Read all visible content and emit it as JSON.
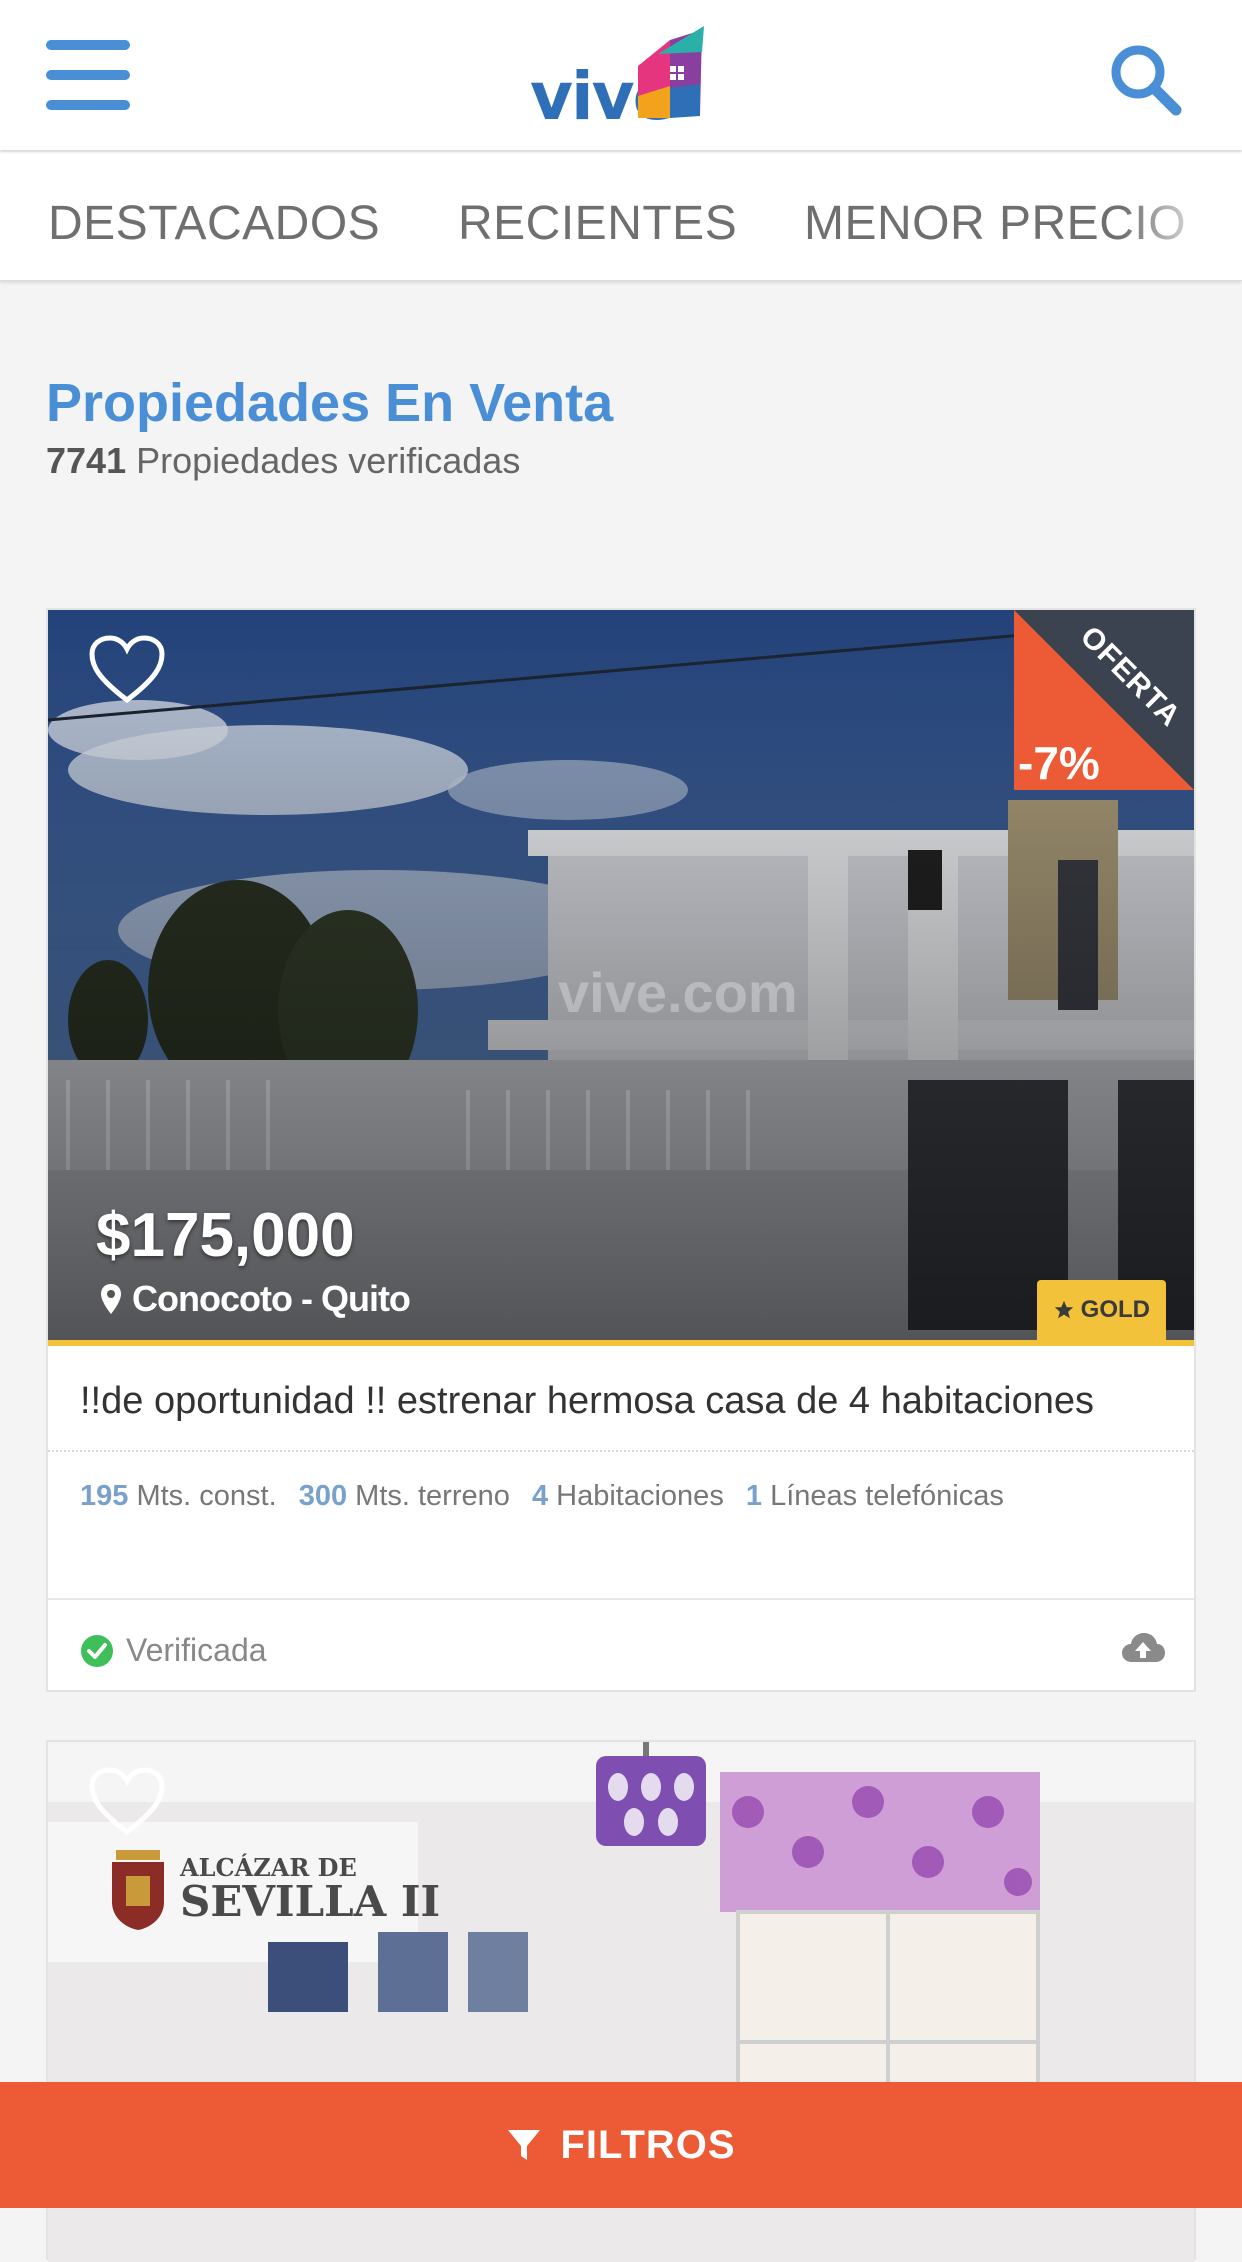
{
  "header": {
    "logo_text": "vive",
    "menu_icon": "hamburger-menu-icon",
    "search_icon": "search-icon",
    "accent_color": "#4a8fd6"
  },
  "tabs": [
    {
      "label": "DESTACADOS"
    },
    {
      "label": "RECIENTES"
    },
    {
      "label": "MENOR PRECIO"
    }
  ],
  "section": {
    "title": "Propiedades En Venta",
    "count": "7741",
    "count_label": "Propiedades verificadas"
  },
  "listings": [
    {
      "offer_label": "OFERTA",
      "offer_discount": "-7%",
      "price": "$175,000",
      "location": "Conocoto - Quito",
      "badge": "GOLD",
      "title": "!!de oportunidad !! estrenar hermosa casa de 4 habitaciones",
      "features": [
        {
          "value": "195",
          "label": "Mts. const."
        },
        {
          "value": "300",
          "label": "Mts. terreno"
        },
        {
          "value": "4",
          "label": "Habitaciones"
        },
        {
          "value": "1",
          "label": "Líneas telefónicas"
        }
      ],
      "status": "Verificada",
      "watermark": "vive.com"
    },
    {
      "photo_logo_line1": "ALCÁZAR DE",
      "photo_logo_line2": "SEVILLA II"
    }
  ],
  "filter_bar": {
    "label": "FILTROS",
    "color": "#ec5b35"
  }
}
